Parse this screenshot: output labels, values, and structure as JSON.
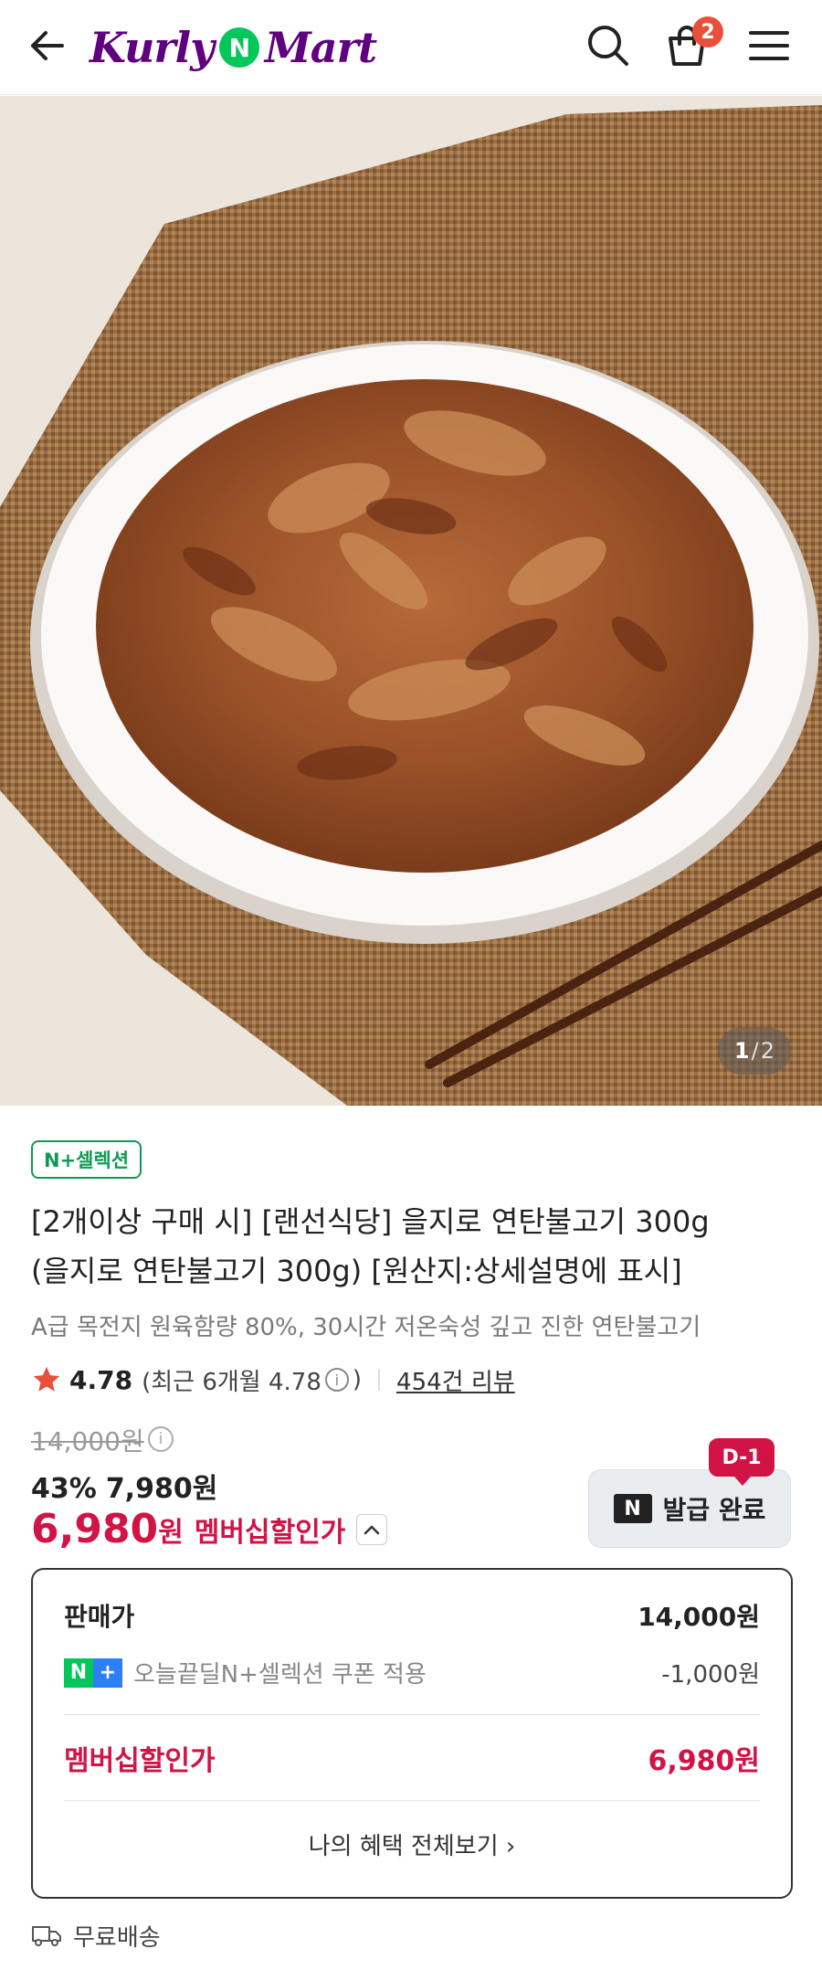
{
  "header": {
    "logo_left": "Kurly",
    "logo_mid": "N",
    "logo_right": "Mart",
    "cart_count": "2",
    "icons": [
      "arrow-left-icon",
      "search-icon",
      "shopping-bag-icon",
      "menu-icon"
    ]
  },
  "gallery": {
    "current": "1",
    "separator": "/",
    "total": "2"
  },
  "product": {
    "badge": "N+셀렉션",
    "title_line1": "[2개이상 구매 시] [랜선식당] 을지로 연탄불고기 300g",
    "title_line2": "(을지로 연탄불고기 300g) [원산지:상세설명에 표시]",
    "subtitle": "A급 목전지 원육함량 80%, 30시간 저온숙성 깊고 진한 연탄불고기",
    "rating_score": "4.78",
    "rating_recent": "(최근 6개월 4.78",
    "rating_info": "i",
    "rating_close": ")",
    "review_count": "454건 리뷰"
  },
  "price": {
    "original": "14,000원",
    "discount_rate": "43%",
    "discount_price": "7,980원",
    "member_price": "6,980",
    "member_won": "원",
    "member_label": "멤버십할인가"
  },
  "coupon": {
    "dday": "D-1",
    "logo": "N",
    "label": "발급 완료"
  },
  "breakdown": {
    "seller_label": "판매가",
    "seller_value": "14,000원",
    "coupon_label": "오늘끝딜N+셀렉션 쿠폰 적용",
    "coupon_value": "-1,000원",
    "member_label": "멤버십할인가",
    "member_value": "6,980원",
    "view_all": "나의 혜택 전체보기 ›"
  },
  "shipping": {
    "label": "무료배송"
  },
  "colors": {
    "brand_purple": "#5f0080",
    "naver_green": "#03c75a",
    "member_red": "#d11345"
  }
}
